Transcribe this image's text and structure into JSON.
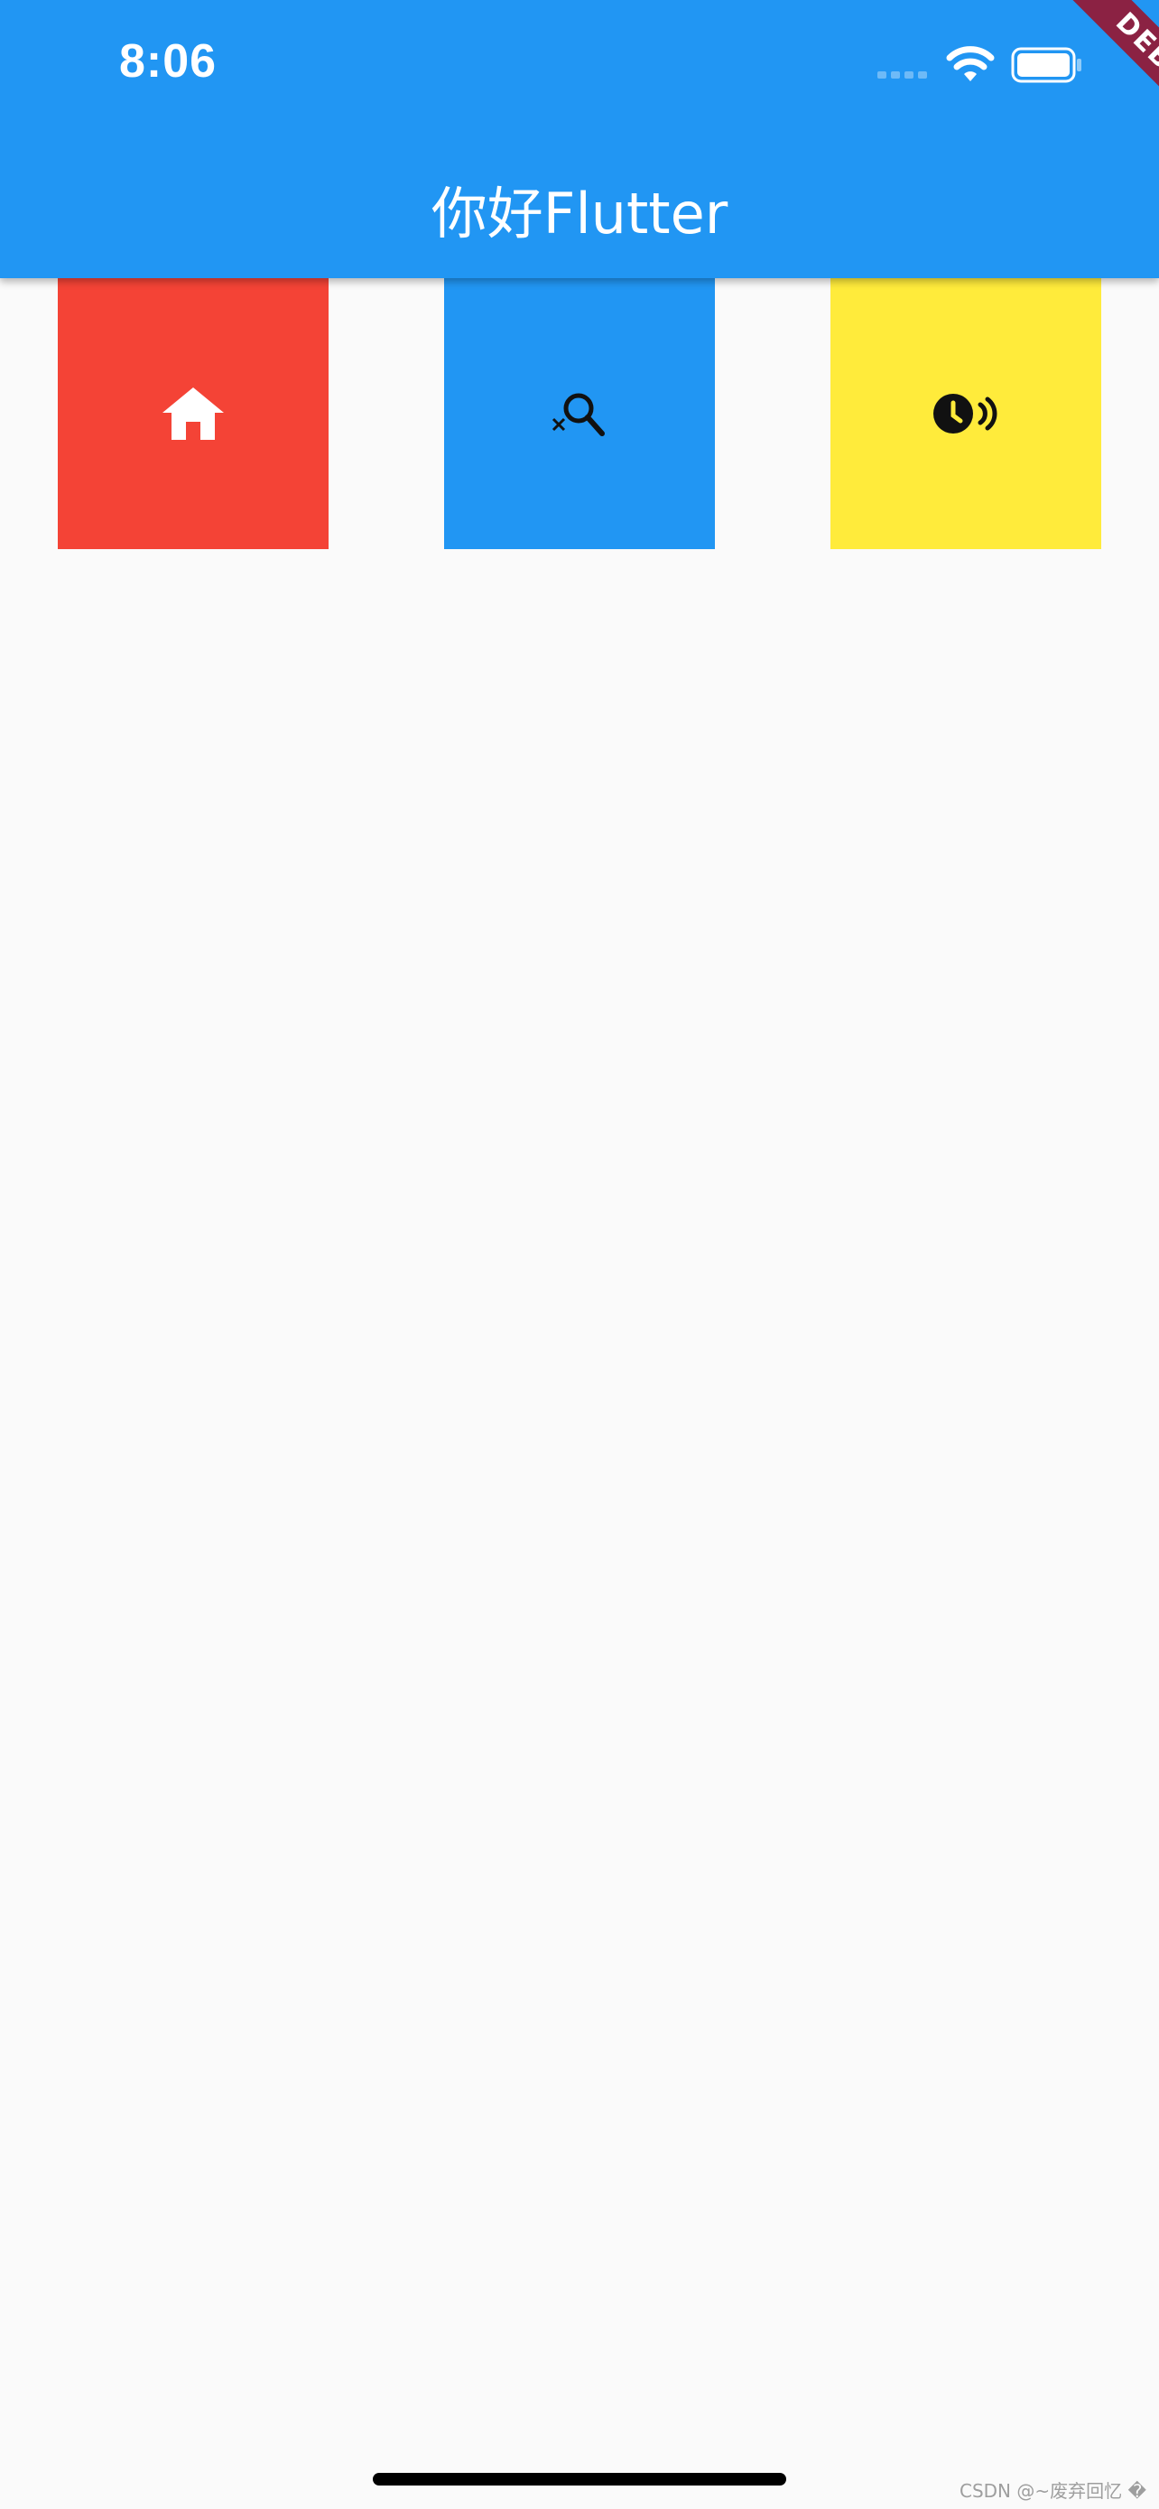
{
  "status_bar": {
    "time": "8:06"
  },
  "app_bar": {
    "title": "你好Flutter",
    "color": "#2196f3"
  },
  "debug_banner": {
    "label": "DEBUG",
    "color": "#8b2243"
  },
  "tiles": [
    {
      "icon": "home-icon",
      "background": "#f44336"
    },
    {
      "icon": "search-off-icon",
      "background": "#2196f3"
    },
    {
      "icon": "schedule-send-icon",
      "background": "#ffeb3b"
    }
  ],
  "watermark": "CSDN @~废弃回忆 �"
}
